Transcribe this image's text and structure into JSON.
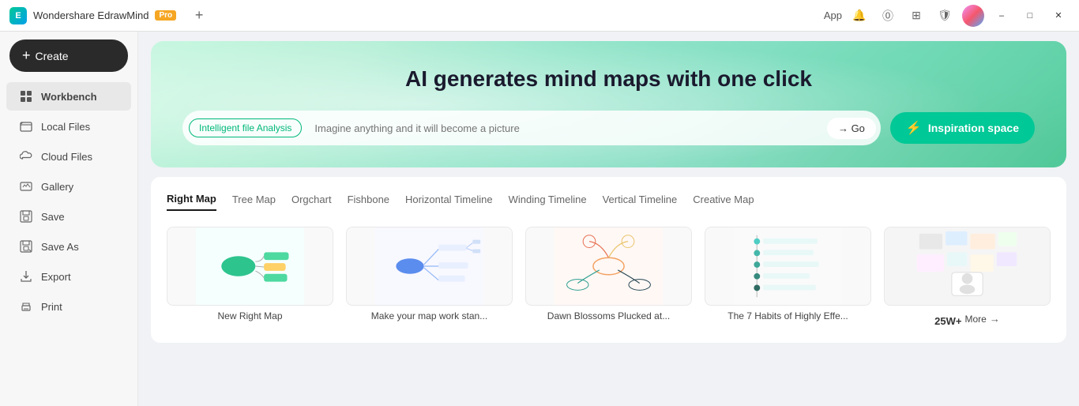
{
  "titlebar": {
    "logo_text": "E",
    "app_name": "Wondershare EdrawMind",
    "pro_label": "Pro",
    "add_tab_label": "+",
    "avatar_alt": "user avatar",
    "header_app_label": "App",
    "window_controls": [
      "minimize",
      "restore",
      "close"
    ]
  },
  "sidebar": {
    "create_label": "+ Create",
    "items": [
      {
        "id": "workbench",
        "label": "Workbench",
        "icon": "⬜",
        "active": true
      },
      {
        "id": "local-files",
        "label": "Local Files",
        "icon": "📁"
      },
      {
        "id": "cloud-files",
        "label": "Cloud Files",
        "icon": "☁"
      },
      {
        "id": "gallery",
        "label": "Gallery",
        "icon": "💬"
      },
      {
        "id": "save",
        "label": "Save",
        "icon": "💾"
      },
      {
        "id": "save-as",
        "label": "Save As",
        "icon": "💾"
      },
      {
        "id": "export",
        "label": "Export",
        "icon": "📤"
      },
      {
        "id": "print",
        "label": "Print",
        "icon": "🖨"
      }
    ]
  },
  "banner": {
    "title": "AI generates mind maps with one click",
    "search_tag": "Intelligent file Analysis",
    "search_placeholder": "Imagine anything and it will become a picture",
    "go_label": "→ Go",
    "inspiration_label": "Inspiration space"
  },
  "templates": {
    "tabs": [
      {
        "id": "right-map",
        "label": "Right Map",
        "active": true
      },
      {
        "id": "tree-map",
        "label": "Tree Map"
      },
      {
        "id": "orgchart",
        "label": "Orgchart"
      },
      {
        "id": "fishbone",
        "label": "Fishbone"
      },
      {
        "id": "horizontal-timeline",
        "label": "Horizontal Timeline"
      },
      {
        "id": "winding-timeline",
        "label": "Winding Timeline"
      },
      {
        "id": "vertical-timeline",
        "label": "Vertical Timeline"
      },
      {
        "id": "creative-map",
        "label": "Creative Map"
      }
    ],
    "cards": [
      {
        "id": "new-right-map",
        "label": "New Right Map"
      },
      {
        "id": "make-work-stand",
        "label": "Make your map work stan..."
      },
      {
        "id": "dawn-blossoms",
        "label": "Dawn Blossoms Plucked at..."
      },
      {
        "id": "7-habits",
        "label": "The 7 Habits of Highly Effe..."
      },
      {
        "id": "more",
        "label": "More",
        "is_more": true,
        "count": "25W+"
      }
    ]
  }
}
